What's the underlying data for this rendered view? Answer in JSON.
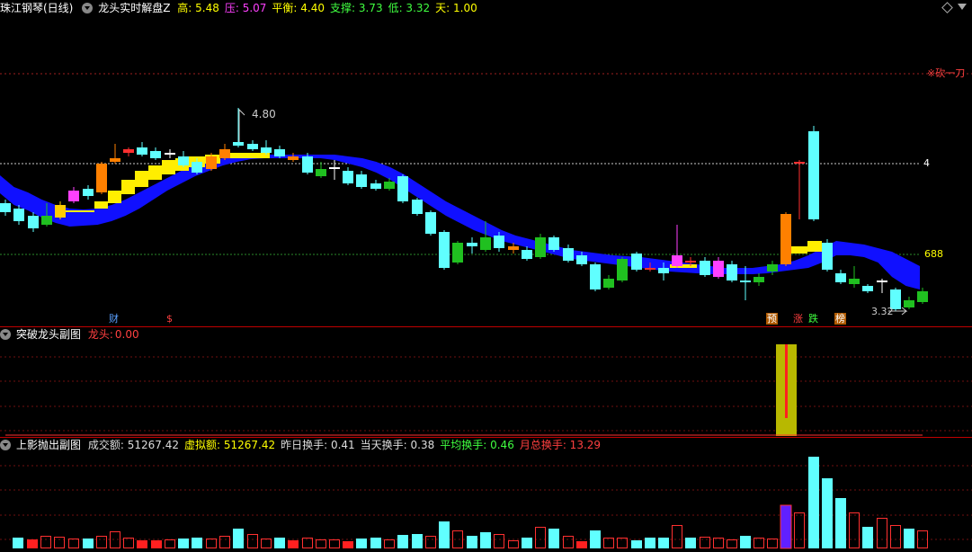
{
  "main_header": {
    "stock_name": "珠江钢琴(日线)",
    "indicator_name": "龙头实时解盘Z",
    "items": [
      {
        "label": "高:",
        "value": "5.48",
        "color": "#ffff00"
      },
      {
        "label": "压:",
        "value": "5.07",
        "color": "#ff40ff"
      },
      {
        "label": "平衡:",
        "value": "4.40",
        "color": "#ffff00"
      },
      {
        "label": "支撑:",
        "value": "3.73",
        "color": "#40ff40"
      },
      {
        "label": "低:",
        "value": "3.32",
        "color": "#40ff40"
      },
      {
        "label": "天:",
        "value": "1.00",
        "color": "#ffff00"
      }
    ]
  },
  "main_chart": {
    "price_high_label": "4.80",
    "price_low_label": "3.32",
    "level_4_label": "4",
    "level_688_label": "688",
    "red_line_label": "※砍一刀",
    "markers": {
      "cai": "财",
      "dollar": "$",
      "yu": "预",
      "zhang": "涨",
      "die": "跌",
      "bang": "榜"
    }
  },
  "sub1_header": {
    "title": "突破龙头副图",
    "label": "龙头:",
    "value": "0.00"
  },
  "sub2_header": {
    "title": "上影抛出副图",
    "items": [
      {
        "label": "成交额:",
        "value": "51267.42",
        "color": "#dddddd"
      },
      {
        "label": "虚拟额:",
        "value": "51267.42",
        "color": "#ffff00"
      },
      {
        "label": "昨日换手:",
        "value": "0.41",
        "color": "#dddddd"
      },
      {
        "label": "当天换手:",
        "value": "0.38",
        "color": "#dddddd"
      },
      {
        "label": "平均换手:",
        "value": "0.46",
        "color": "#40ff40"
      },
      {
        "label": "月总换手:",
        "value": "13.29",
        "color": "#ff4040"
      }
    ]
  },
  "top_right_icons": [
    "diamond-icon",
    "expand-icon"
  ]
}
